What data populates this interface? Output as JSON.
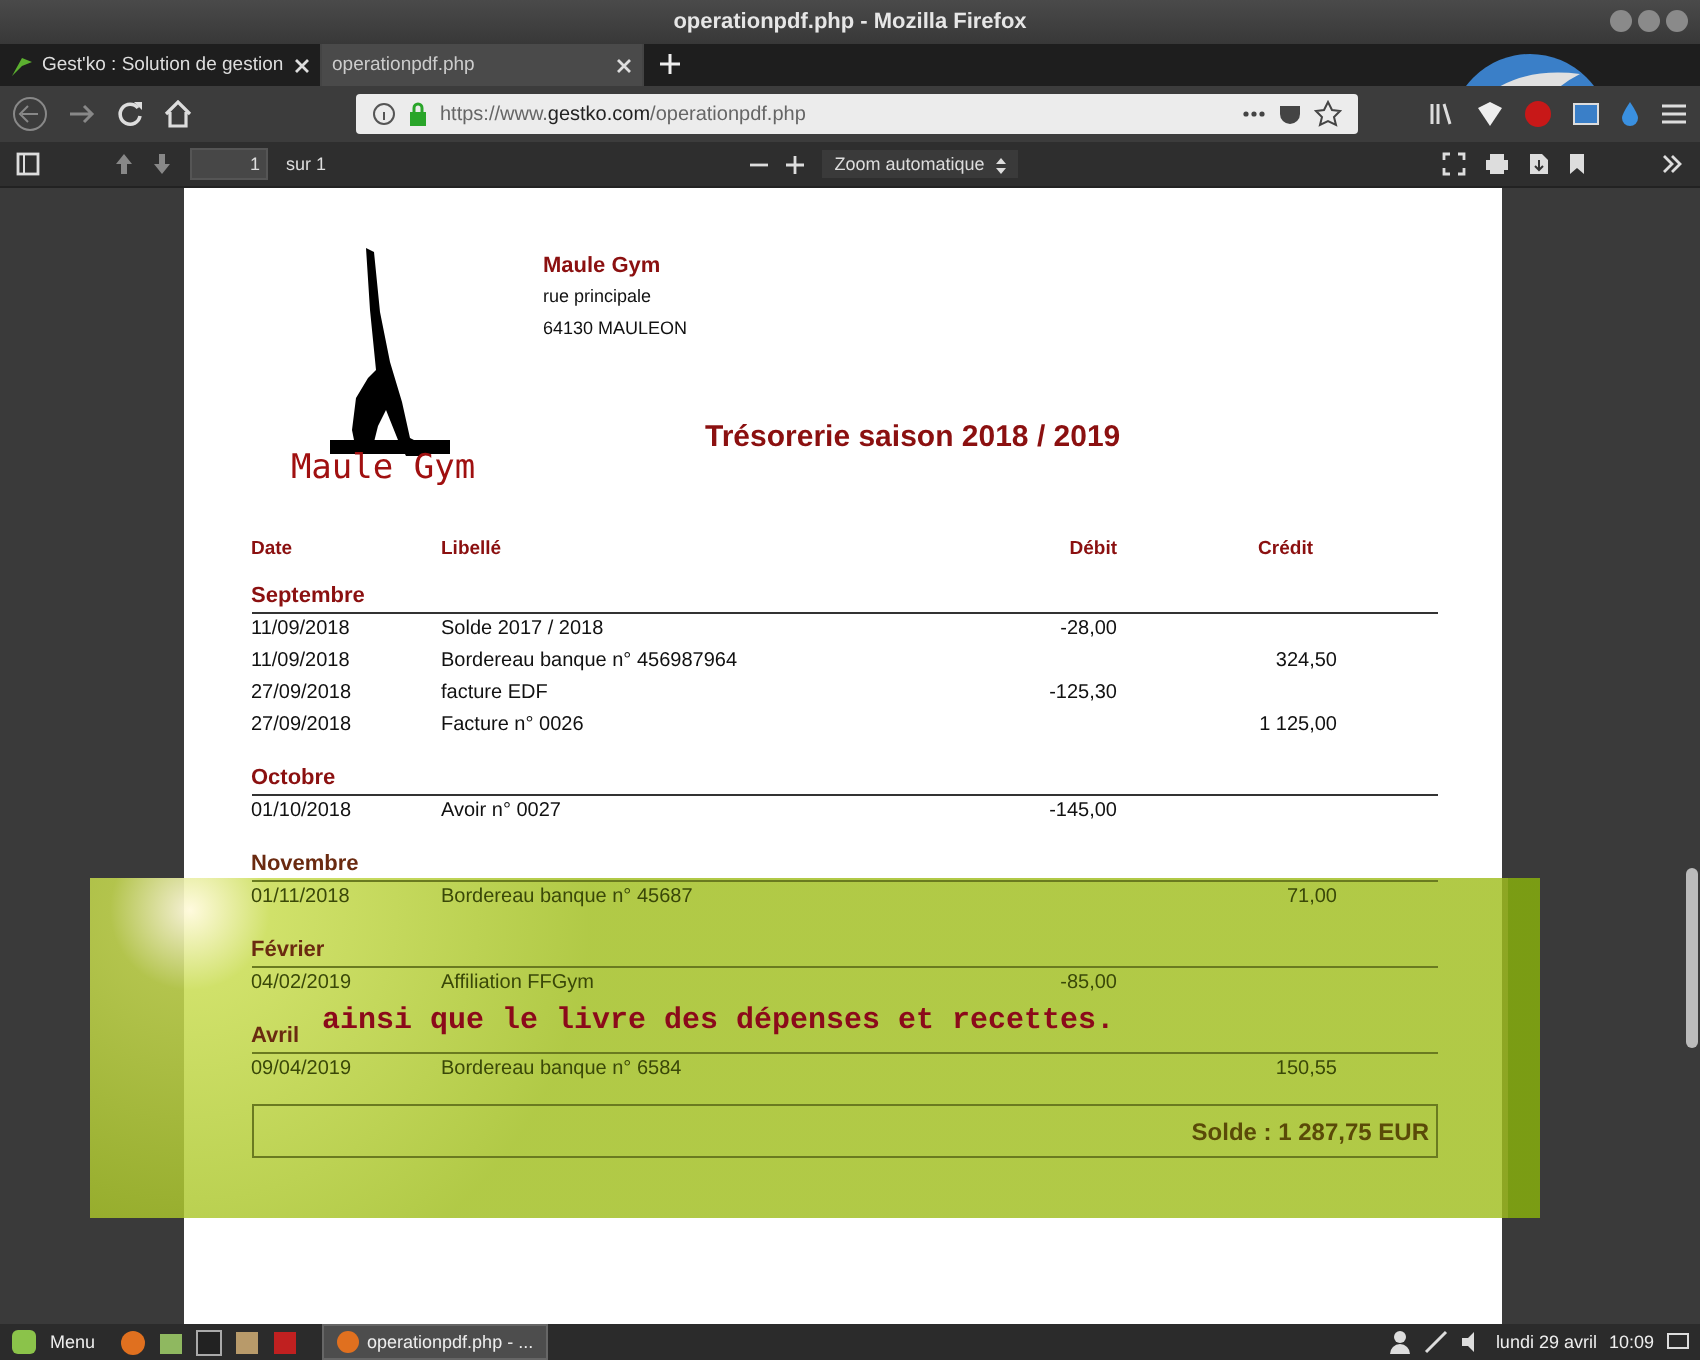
{
  "window": {
    "title": "operationpdf.php - Mozilla Firefox"
  },
  "tabs": [
    {
      "label": "Gest'ko : Solution de gestion",
      "selected": false
    },
    {
      "label": "operationpdf.php",
      "selected": true
    }
  ],
  "url": {
    "prefix": "https://www.",
    "domain": "gestko.com",
    "path": "/operationpdf.php"
  },
  "pdf_toolbar": {
    "page": "1",
    "of": "sur 1",
    "zoom": "Zoom automatique"
  },
  "document": {
    "logo_text": "Maule Gym",
    "company": {
      "name": "Maule Gym",
      "street": "rue principale",
      "city": "64130 MAULEON"
    },
    "title": "Trésorerie saison 2018 / 2019",
    "columns": [
      "Date",
      "Libellé",
      "Débit",
      "Crédit"
    ],
    "sections": [
      {
        "month": "Septembre",
        "rows": [
          {
            "date": "11/09/2018",
            "label": "Solde 2017 / 2018",
            "debit": "-28,00"
          },
          {
            "date": "11/09/2018",
            "label": "Bordereau banque n° 456987964",
            "credit": "324,50"
          },
          {
            "date": "27/09/2018",
            "label": "facture EDF",
            "debit": "-125,30"
          },
          {
            "date": "27/09/2018",
            "label": "Facture n° 0026",
            "credit": "1 125,00"
          }
        ]
      },
      {
        "month": "Octobre",
        "rows": [
          {
            "date": "01/10/2018",
            "label": "Avoir n° 0027",
            "debit": "-145,00"
          }
        ]
      },
      {
        "month": "Novembre",
        "rows": [
          {
            "date": "01/11/2018",
            "label": "Bordereau banque n° 45687",
            "credit": "71,00"
          }
        ]
      },
      {
        "month": "Février",
        "rows": [
          {
            "date": "04/02/2019",
            "label": "Affiliation FFGym",
            "debit": "-85,00"
          }
        ]
      },
      {
        "month": "Avril",
        "rows": [
          {
            "date": "09/04/2019",
            "label": "Bordereau banque n° 6584",
            "credit": "150,55"
          }
        ]
      }
    ],
    "balance": "Solde : 1 287,75 EUR"
  },
  "overlay": {
    "caption": "ainsi que le livre des dépenses et recettes."
  },
  "taskbar": {
    "menu": "Menu",
    "window": "operationpdf.php - ...",
    "date": "lundi 29 avril",
    "time": "10:09"
  }
}
